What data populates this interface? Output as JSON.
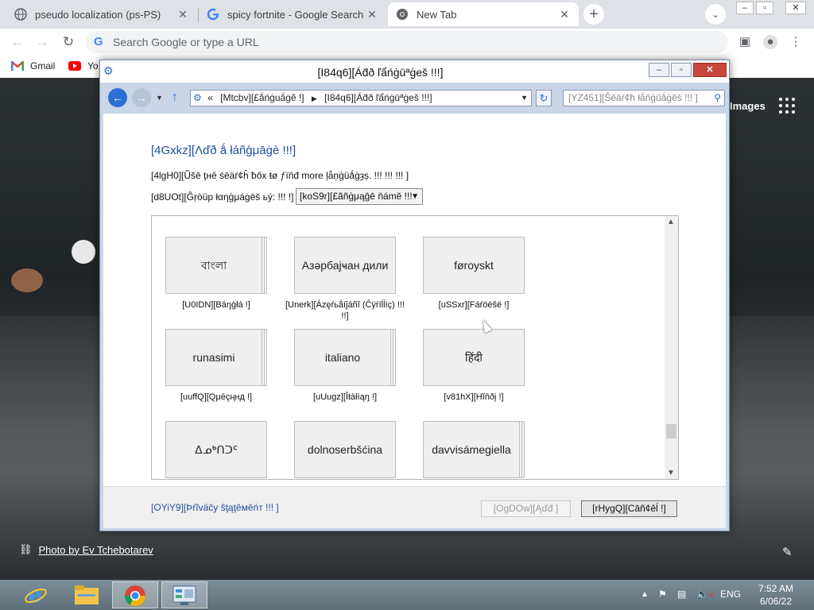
{
  "browser": {
    "tabs": [
      {
        "title": "pseudo localization (ps-PS)",
        "favicon": "globe-icon"
      },
      {
        "title": "spicy fortnite - Google Search",
        "favicon": "google-g-icon"
      },
      {
        "title": "New Tab",
        "favicon": "chrome-icon"
      }
    ],
    "omnibox_placeholder": "Search Google or type a URL",
    "bookmarks": [
      {
        "label": "Gmail",
        "icon": "gmail-icon"
      },
      {
        "label": "Yo",
        "icon": "youtube-icon"
      }
    ]
  },
  "newtab": {
    "images_link": "Images",
    "photo_credit": "Photo by Ev Tchebotarev"
  },
  "dialog": {
    "window_title": "[I84q6][Ád̆ð ľẩńġūªġeš !!!]",
    "breadcrumb": [
      "[Mtcbv][£ắńġuắġẽ !]",
      "[I84q6][Ád̆ð ľẩńġūªġeš !!!]"
    ],
    "search_placeholder": "[YZ451][Šěāŕ¢ħ łắňģűǻģẽš !!! ]",
    "heading": "[4Gxkz][Λďð ǻ łáñģμāġè !!!]",
    "description": "[4lgH0][Ũšē ţнě śēäŕ¢ĥ ƀőx ŧø ƒïňđ more ļǟņģüǻģȝș. !!! !!! !!! ]",
    "group_label": "[d8UOt][Ĝŗòüp łαηģμáġēš ьý: !!! !]",
    "group_value": "[koS9r][£ãñģμąĝē ňámě !!!",
    "languages": [
      {
        "name": "বাংলা",
        "caption": "[U0IDN][Bāŋģłá !]"
      },
      {
        "name": "Азәрбајҹан дили",
        "caption": "[Unerk][Ázęŕьắíĵáñĩ (Ĉÿŕíĺĺíç) !!! !!]"
      },
      {
        "name": "føroyskt",
        "caption": "[uSSxr][Fáŕöëšë !]"
      },
      {
        "name": "runasimi",
        "caption": "[uuffQ][Qμēçңнд !]"
      },
      {
        "name": "italiano",
        "caption": "[uUugz][Ĭŧàłìąŋ !]"
      },
      {
        "name": "हिंदी",
        "caption": "[v81hX][Hĩňðį !]"
      },
      {
        "name": "ᐃᓄᒃᑎᑐᑦ",
        "caption": ""
      },
      {
        "name": "dolnoserbšćina",
        "caption": ""
      },
      {
        "name": "davvisámegiella",
        "caption": ""
      }
    ],
    "privacy_link": "[OYiY9][Þŕĩväĉy ŝţąţěмěńт !!! ]",
    "add_button": "[OgDOw][Ąďđ ]",
    "cancel_button": "[rHygQ][Cāñ¢ěĺ !]"
  },
  "taskbar": {
    "apps": [
      "internet-explorer-icon",
      "file-explorer-icon",
      "chrome-icon",
      "control-panel-icon"
    ],
    "language": "ENG",
    "time": "7:52 AM",
    "date": "6/06/22"
  }
}
